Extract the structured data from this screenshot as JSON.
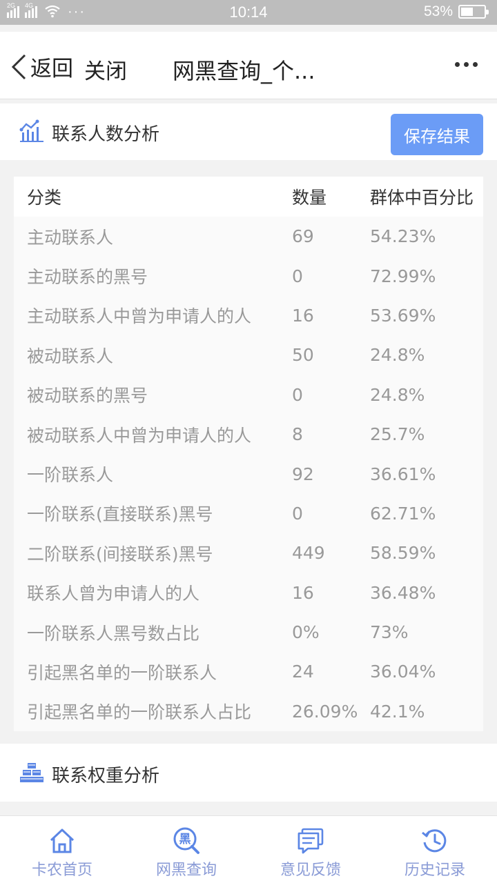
{
  "status_bar": {
    "net_left": "2G",
    "net_right": "4G",
    "dots": "···",
    "time": "10:14",
    "battery": "53%",
    "battery_level": 0.53
  },
  "nav": {
    "back_label": "返回",
    "close_label": "关闭",
    "title": "网黑查询_个..."
  },
  "section1": {
    "title": "联系人数分析",
    "save_label": "保存结果"
  },
  "table": {
    "headers": [
      "分类",
      "数量",
      "群体中百分比"
    ],
    "rows": [
      [
        "主动联系人",
        "69",
        "54.23%"
      ],
      [
        "主动联系的黑号",
        "0",
        "72.99%"
      ],
      [
        "主动联系人中曾为申请人的人",
        "16",
        "53.69%"
      ],
      [
        "被动联系人",
        "50",
        "24.8%"
      ],
      [
        "被动联系的黑号",
        "0",
        "24.8%"
      ],
      [
        "被动联系人中曾为申请人的人",
        "8",
        "25.7%"
      ],
      [
        "一阶联系人",
        "92",
        "36.61%"
      ],
      [
        "一阶联系(直接联系)黑号",
        "0",
        "62.71%"
      ],
      [
        "二阶联系(间接联系)黑号",
        "449",
        "58.59%"
      ],
      [
        "联系人曾为申请人的人",
        "16",
        "36.48%"
      ],
      [
        "一阶联系人黑号数占比",
        "0%",
        "73%"
      ],
      [
        "引起黑名单的一阶联系人",
        "24",
        "36.04%"
      ],
      [
        "引起黑名单的一阶联系人占比",
        "26.09%",
        "42.1%"
      ]
    ]
  },
  "section2": {
    "title": "联系权重分析"
  },
  "tabbar": [
    {
      "label": "卡农首页",
      "icon": "home-icon"
    },
    {
      "label": "网黑查询",
      "icon": "blacklist-search-icon",
      "icon_char": "黑"
    },
    {
      "label": "意见反馈",
      "icon": "feedback-icon"
    },
    {
      "label": "历史记录",
      "icon": "history-icon"
    }
  ],
  "colors": {
    "accent": "#6b9cf6",
    "tab_icon": "#5b86e5",
    "tab_label": "#8a9bd6"
  }
}
